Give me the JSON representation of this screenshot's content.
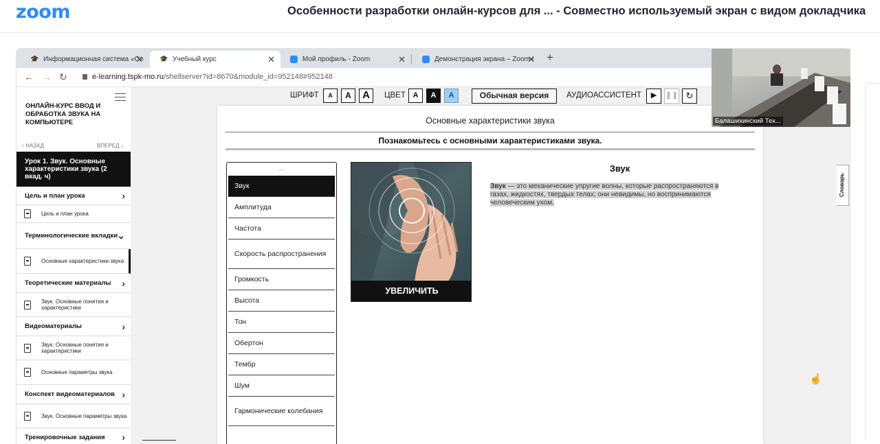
{
  "zoom": {
    "logo": "zoom",
    "title": "Особенности разработки онлайн-курсов для ...  - Совместно используемый экран с видом докладчика"
  },
  "browser": {
    "tabs": [
      {
        "label": "Информационная система «Си",
        "icon": "graduation-cap-icon",
        "active": false
      },
      {
        "label": "Учебный курс",
        "icon": "graduation-cap-icon",
        "active": true
      },
      {
        "label": "Мой профиль - Zoom",
        "icon": "zoom-icon",
        "active": false
      },
      {
        "label": "Демонстрация экрана – Zoom I",
        "icon": "zoom-icon",
        "active": false
      }
    ],
    "new_tab": "+",
    "url_host": "e-learning.tspk-mo.ru",
    "url_path": "/shellserver?id=8670&module_id=952148#952148"
  },
  "sidebar": {
    "course_title": "ОНЛАЙН-КУРС ВВОД И ОБРАБОТКА ЗВУКА НА КОМПЬЮТЕРЕ",
    "back": "↑ НАЗАД",
    "forward": "ВПЕРЕД ↓",
    "lesson": "Урок 1. Звук. Основные характеристики звука (2 вкад. ч)",
    "items": [
      {
        "type": "section",
        "label": "Цель и план урока",
        "chev": "›"
      },
      {
        "type": "sub",
        "label": "Цель и план урока"
      },
      {
        "type": "section",
        "label": "Терминологические вкладки",
        "chev": "⌄"
      },
      {
        "type": "sub",
        "label": "Основные характеристики звука",
        "current": true
      },
      {
        "type": "section",
        "label": "Теоретические материалы",
        "chev": "›"
      },
      {
        "type": "sub",
        "label": "Звук. Основные понятия и характеристики"
      },
      {
        "type": "section",
        "label": "Видеоматериалы",
        "chev": "›"
      },
      {
        "type": "sub",
        "label": "Звук. Основные понятия и характеристики"
      },
      {
        "type": "sub",
        "label": "Основные параметры звука"
      },
      {
        "type": "section",
        "label": "Конспект видеоматериалов",
        "chev": "›"
      },
      {
        "type": "sub",
        "label": "Звук. Основные параметры звука"
      },
      {
        "type": "section",
        "label": "Тренировочные задания",
        "chev": "›"
      }
    ]
  },
  "toolbar": {
    "font_label": "ШРИФТ",
    "color_label": "ЦВЕТ",
    "letter": "A",
    "version": "Обычная версия",
    "audio_label": "АУДИОАССИСТЕНТ"
  },
  "content": {
    "heading": "Основные характеристики звука",
    "subheading": "Познакомьтесь с основными характеристиками звука.",
    "terms": [
      "Звук",
      "Амплитуда",
      "Частота",
      "Скорость распространения",
      "Громкость",
      "Высота",
      "Тон",
      "Обертон",
      "Тембр",
      "Шум",
      "Гармонические колебания"
    ],
    "enlarge": "УВЕЛИЧИТЬ",
    "def_title": "Звук",
    "def_term": "Звук",
    "def_body": " — это механические упругие волны, которые распространяются в газах, жидкостях, твердых телах; они невидимы, но воспринимаются человеческим ухом."
  },
  "dictionary_tab": "Словарь",
  "video": {
    "name": "Балашихинский Тех..."
  },
  "colors": {
    "zoom_blue": "#2d8cff",
    "active_term": "#111111"
  }
}
